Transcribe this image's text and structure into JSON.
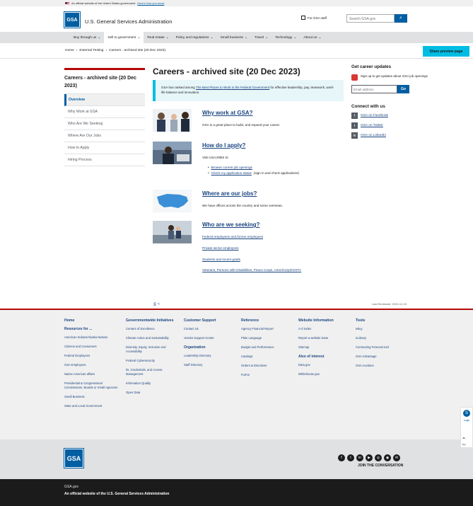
{
  "banner": {
    "text": "An official website of the United States government",
    "link": "Here's how you know"
  },
  "header": {
    "logo": "GSA",
    "title": "U.S. General Services Administration",
    "for_gsa": "For GSA staff",
    "search_placeholder": "Search GSA.gov",
    "search_icon": "search-icon"
  },
  "nav": [
    {
      "label": "Buy through us"
    },
    {
      "label": "Sell to government",
      "active": true
    },
    {
      "label": "Real estate"
    },
    {
      "label": "Policy and regulations"
    },
    {
      "label": "Small business"
    },
    {
      "label": "Travel"
    },
    {
      "label": "Technology"
    },
    {
      "label": "About us"
    }
  ],
  "breadcrumb": [
    "Home",
    "External Testing",
    "Careers - archived site (20 Dec 2023)"
  ],
  "share_button": "Share preview page",
  "sidenav": {
    "title": "Careers - archived site (20 Dec 2023)",
    "items": [
      "Overview",
      "Why Work at GSA",
      "Who Are We Seeking",
      "Where Are Our Jobs",
      "How to Apply",
      "Hiring Process"
    ]
  },
  "main": {
    "title": "Careers - archived site (20 Dec 2023)",
    "alert_pre": "GSA has ranked among ",
    "alert_link": "The Best Places to Work in the Federal Government",
    "alert_post": " for effective leadership, pay, teamwork, work-life balance and innovation.",
    "sections": [
      {
        "title": "Why work at GSA?",
        "text": "GSA is a great place to build, and expand your career."
      },
      {
        "title": "How do I apply?",
        "text": "Visit USAJOBS to:",
        "bullets": [
          "Browse current job openings",
          "Check my application status"
        ],
        "bullet2_post": " (sign in and check applications)"
      },
      {
        "title": "Where are our jobs?",
        "text": "We have offices across the country and some overseas."
      },
      {
        "title": "Who are we seeking?",
        "links": [
          "Federal employees and former employees",
          "Private sector employees",
          "Students and recent grads",
          "Veterans, Persons with Disabilities, Peace Corps, AmeriCorps/VISTA"
        ]
      }
    ]
  },
  "right": {
    "updates_title": "Get career updates",
    "signup_text": "Sign up to get updates about GSA job openings",
    "email_placeholder": "Email address",
    "go": "Go",
    "connect_title": "Connect with us",
    "social": [
      {
        "label": "GSA on Facebook",
        "icon": "f"
      },
      {
        "label": "GSA on Twitter",
        "icon": "t"
      },
      {
        "label": "GSA on LinkedIn",
        "icon": "in"
      }
    ]
  },
  "last_reviewed": "Last Reviewed: 2023-12-20",
  "footer": {
    "cols": [
      {
        "head": "Home",
        "sub": "Resources for ...",
        "links": [
          "American Indians/Alaska Natives",
          "Citizens and Consumers",
          "Federal Employees",
          "GSA Employees",
          "Native American affairs",
          "Presidential & Congressional Commissions, Boards or Small Agencies",
          "Small Business",
          "State and Local Government"
        ]
      },
      {
        "head": "Governmentwide Initiatives",
        "links": [
          "Centers of Excellence",
          "Climate Action and Sustainability",
          "Diversity, Equity, Inclusion and Accessibility",
          "Federal Cybersecurity",
          "ID, Credentials, and Access Management",
          "Information Quality",
          "Open Data"
        ]
      },
      {
        "head": "Customer Support",
        "links": [
          "Contact Us",
          "Vendor Support Center"
        ],
        "sub": "Organization",
        "links2": [
          "Leadership Directory",
          "Staff Directory"
        ]
      },
      {
        "head": "Reference",
        "links": [
          "Agency Financial Report",
          "Plain Language",
          "Budget and Performance",
          "Catalogs",
          "Orders & Directives",
          "Forms"
        ]
      },
      {
        "head": "Website Information",
        "links": [
          "A-Z Index",
          "Report a website issue",
          "Sitemap"
        ],
        "sub": "Also of interest",
        "links2": [
          "Data.gov",
          "Whitehouse.gov"
        ]
      },
      {
        "head": "Tools",
        "links": [
          "eBuy",
          "eLibrary",
          "Contracting Forecast tool",
          "GSA Advantage",
          "GSA Auctions"
        ]
      }
    ]
  },
  "bottom": {
    "logo": "GSA",
    "join": "JOIN THE CONVERSATION",
    "social_icons": [
      "facebook-icon",
      "twitter-icon",
      "linkedin-icon",
      "youtube-icon",
      "instagram-icon",
      "rss-icon",
      "email-icon"
    ]
  },
  "identifier": {
    "domain": "GSA.gov",
    "official": "An official website of the U.S. General Services Administration"
  },
  "float": {
    "label": "Login",
    "totop": "Top"
  }
}
